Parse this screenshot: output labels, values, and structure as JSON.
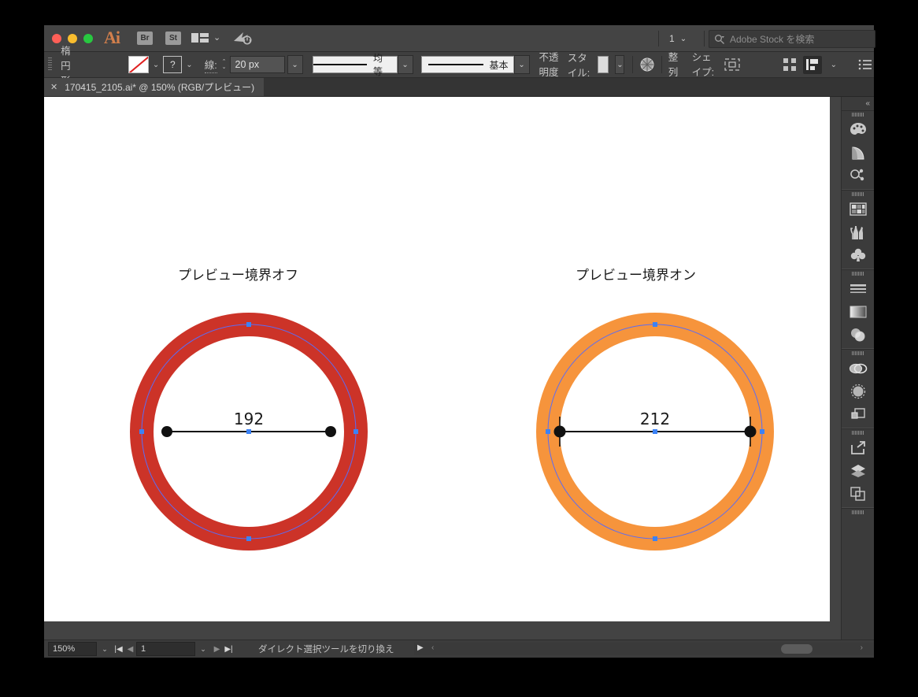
{
  "window": {
    "app_name": "Ai",
    "bridge_button": "Br",
    "stock_button": "St",
    "page_number": "1",
    "stock_search_placeholder": "Adobe Stock を検索"
  },
  "control_bar": {
    "object_label": "楕円形",
    "fill_swatch": "none",
    "stroke_swatch": "?",
    "stroke_label": "線:",
    "stroke_weight": "20 px",
    "profile_label": "均等",
    "brush_label": "基本",
    "opacity_label": "不透明度",
    "style_label": "スタイル:",
    "align_label": "整列",
    "shape_label": "シェイプ:"
  },
  "document_tab": {
    "close": "✕",
    "title": "170415_2105.ai* @ 150% (RGB/プレビュー)"
  },
  "canvas": {
    "left_label": "プレビュー境界オフ",
    "right_label": "プレビュー境界オン",
    "left_measure": "192",
    "right_measure": "212",
    "left_stroke_color": "#cc3328",
    "right_stroke_color": "#f6943c",
    "path_color": "#5b6cf5",
    "anchor_color": "#3b82f6"
  },
  "dock": {
    "collapse": "«",
    "groups": [
      {
        "icons": [
          "color-icon",
          "color-guide-icon",
          "shape-builder-icon"
        ]
      },
      {
        "icons": [
          "swatches-icon",
          "brushes-icon",
          "symbols-icon"
        ]
      },
      {
        "icons": [
          "stroke-icon",
          "gradient-icon",
          "transparency-icon"
        ]
      },
      {
        "icons": [
          "links-icon",
          "appearance-icon",
          "pathfinder-icon"
        ]
      },
      {
        "icons": [
          "asset-export-icon",
          "layers-icon",
          "artboards-icon"
        ]
      }
    ]
  },
  "status_bar": {
    "zoom": "150%",
    "page": "1",
    "message": "ダイレクト選択ツールを切り換え"
  }
}
